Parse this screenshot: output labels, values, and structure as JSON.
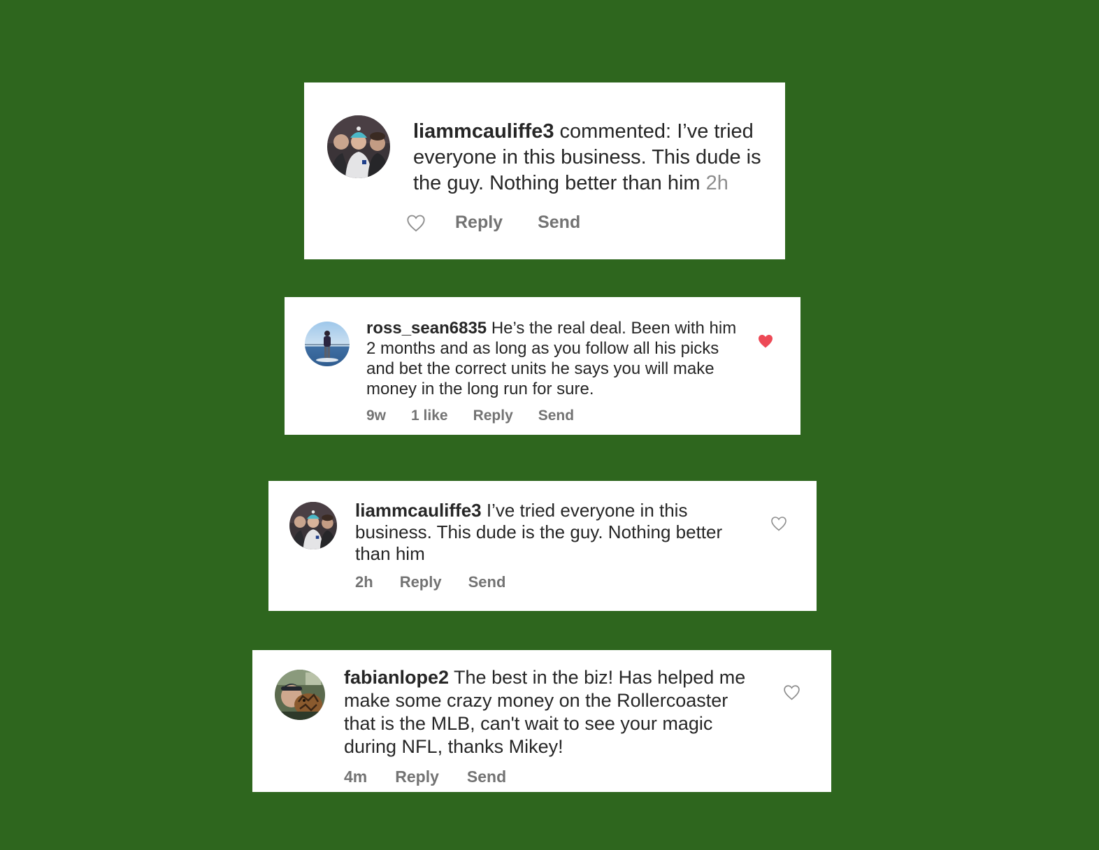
{
  "colors": {
    "background": "#2e661e",
    "card": "#ffffff",
    "text": "#262626",
    "muted": "#8e8e8e",
    "liked_heart": "#ed4956"
  },
  "comments": [
    {
      "username": "liammcauliffe3",
      "prefix": "commented: ",
      "text": "I’ve tried everyone in this business. This dude is the guy. Nothing better than him",
      "time": "2h",
      "reply_label": "Reply",
      "send_label": "Send",
      "heart_icon": "heart-outline-icon",
      "liked": false
    },
    {
      "username": "ross_sean6835",
      "text": "He’s the real deal. Been with him 2 months and as long as you follow all his picks and bet the correct units he says you will make money in the long run for sure.",
      "time": "9w",
      "likes": "1 like",
      "reply_label": "Reply",
      "send_label": "Send",
      "heart_icon": "heart-filled-icon",
      "liked": true
    },
    {
      "username": "liammcauliffe3",
      "text": "I’ve tried everyone in this business. This dude is the guy. Nothing better than him",
      "time": "2h",
      "reply_label": "Reply",
      "send_label": "Send",
      "heart_icon": "heart-outline-icon",
      "liked": false
    },
    {
      "username": "fabianlope2",
      "text": "The best in the biz! Has helped me make some crazy money on the Rollercoaster that is the MLB, can't wait to see your magic during NFL, thanks Mikey!",
      "time": "4m",
      "reply_label": "Reply",
      "send_label": "Send",
      "heart_icon": "heart-outline-icon",
      "liked": false
    }
  ]
}
